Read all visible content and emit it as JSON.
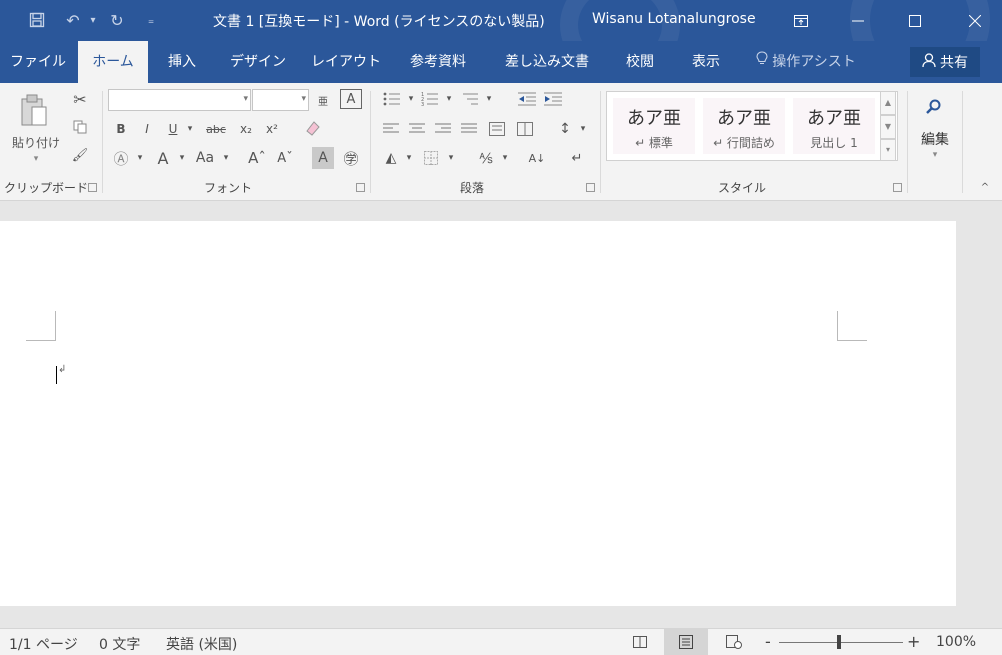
{
  "titlebar": {
    "title": "文書 1 [互換モード] - Word (ライセンスのない製品)",
    "user": "Wisanu Lotanalungrose",
    "icons": {
      "save": "save-icon",
      "undo": "undo-icon",
      "redo": "redo-icon",
      "customize": "customize-qat-icon"
    }
  },
  "tabs": [
    {
      "label": "ファイル"
    },
    {
      "label": "ホーム",
      "active": true
    },
    {
      "label": "挿入"
    },
    {
      "label": "デザイン"
    },
    {
      "label": "レイアウト"
    },
    {
      "label": "参考資料"
    },
    {
      "label": "差し込み文書"
    },
    {
      "label": "校閲"
    },
    {
      "label": "表示"
    },
    {
      "label": "操作アシスト"
    }
  ],
  "share_label": "共有",
  "ribbon": {
    "clipboard": {
      "label": "クリップボード",
      "paste": "貼り付け"
    },
    "font": {
      "label": "フォント",
      "font_name": "",
      "font_size": ""
    },
    "paragraph": {
      "label": "段落"
    },
    "styles": {
      "label": "スタイル",
      "items": [
        {
          "sample": "あア亜",
          "name": "↵ 標準"
        },
        {
          "sample": "あア亜",
          "name": "↵ 行間詰め"
        },
        {
          "sample": "あア亜",
          "name": "見出し 1"
        }
      ]
    },
    "editing": {
      "label": "編集"
    }
  },
  "status": {
    "page": "1/1 ページ",
    "words": "0 文字",
    "language": "英語 (米国)",
    "zoom": "100%",
    "zoom_minus": "-",
    "zoom_plus": "+"
  },
  "colors": {
    "accent": "#2b579a",
    "ribbon": "#f3f3f3",
    "canvas": "#e6e6e6"
  }
}
